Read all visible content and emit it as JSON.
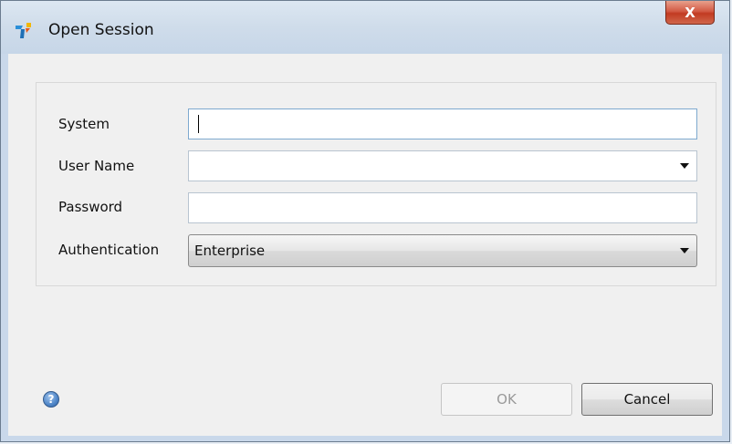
{
  "window": {
    "title": "Open Session",
    "close_glyph": "X"
  },
  "form": {
    "system_label": "System",
    "system_value": "",
    "username_label": "User Name",
    "username_value": "",
    "password_label": "Password",
    "password_value": "",
    "authentication_label": "Authentication",
    "authentication_value": "Enterprise"
  },
  "buttons": {
    "ok_label": "OK",
    "cancel_label": "Cancel",
    "help_glyph": "?"
  },
  "icons": {
    "app": "app-logo-icon",
    "help": "help-icon",
    "dropdown": "chevron-down-icon"
  },
  "colors": {
    "titlebar": "#cfdcea",
    "close_button": "#c23b22",
    "disabled_text": "#9a9a9a"
  }
}
